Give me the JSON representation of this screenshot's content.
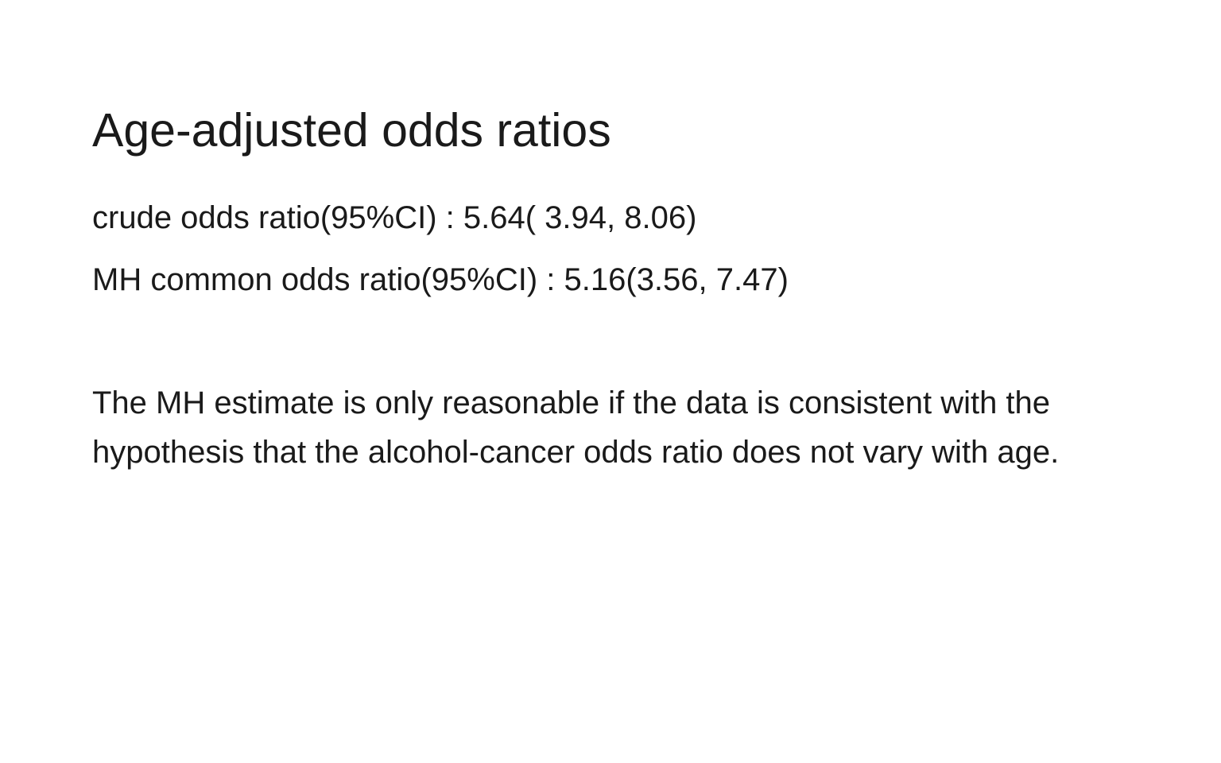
{
  "slide": {
    "title": "Age-adjusted odds ratios",
    "stats": {
      "crude": "crude odds ratio(95%CI) : 5.64( 3.94, 8.06)",
      "mh": "MH common odds ratio(95%CI) : 5.16(3.56, 7.47)"
    },
    "note_lines": [
      "The MH estimate is only reasonable if the data is consistent with the",
      "hypothesis that the alcohol-cancer odds ratio does not vary with age."
    ]
  }
}
